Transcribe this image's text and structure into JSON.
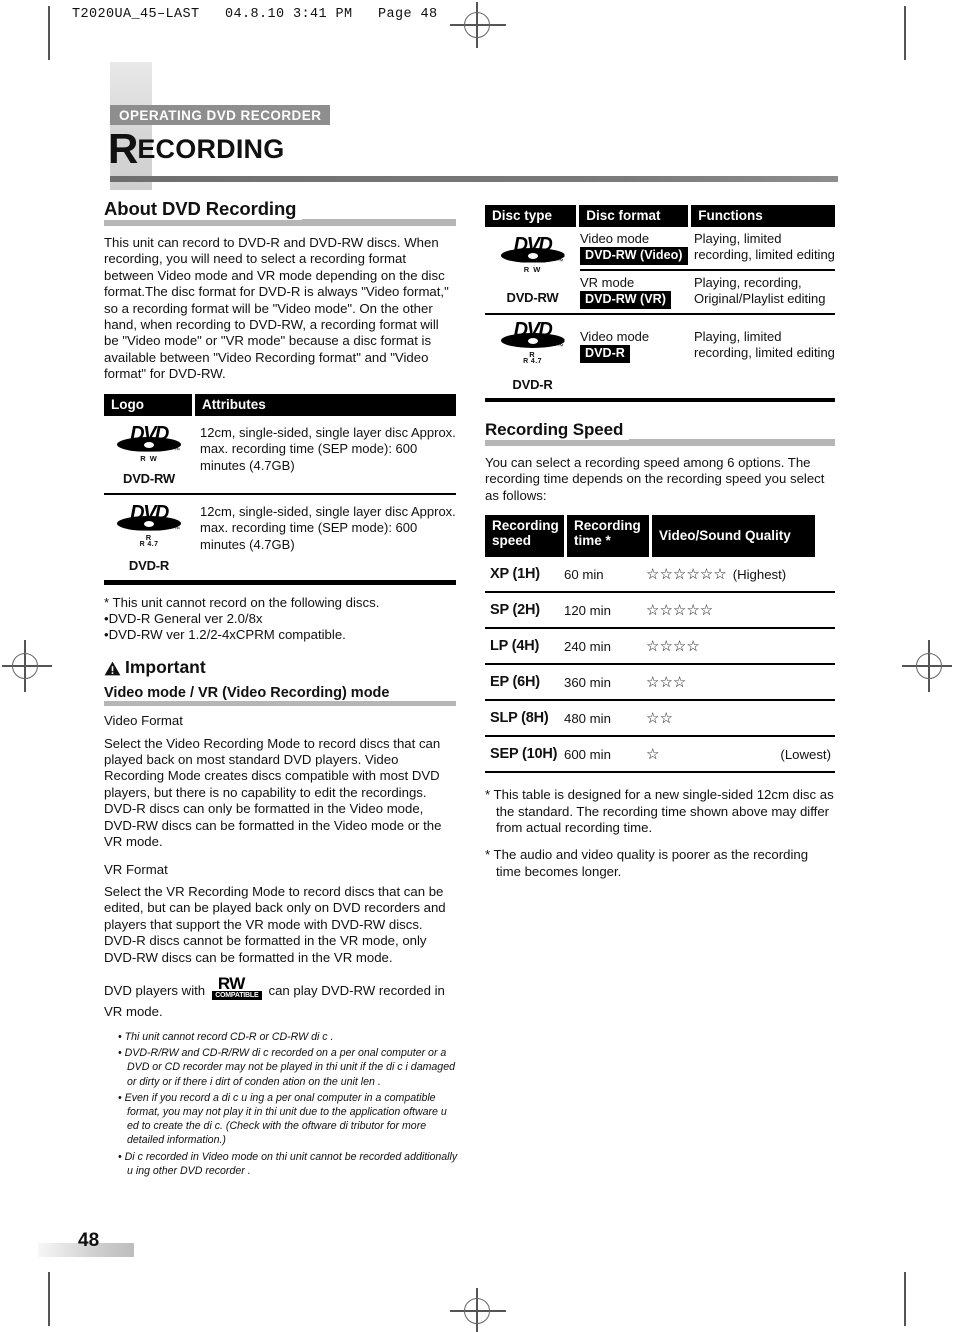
{
  "file_header": "T2020UA_45–LAST   04.8.10 3:41 PM   Page 48",
  "section_badge": "OPERATING DVD RECORDER",
  "chapter": {
    "dropcap": "R",
    "rest": "ECORDING"
  },
  "page_number": "48",
  "left": {
    "heading": "About DVD Recording",
    "intro": "This unit can record to DVD-R and DVD-RW discs. When recording, you will need to select a recording format between Video mode and VR mode depending on the disc format.The disc format for DVD-R is always \"Video format,\" so a recording format will be \"Video mode\". On the other hand, when recording to DVD-RW, a recording format will be \"Video mode\" or \"VR mode\" because a disc format is available between \"Video Recording format\" and \"Video format\" for DVD-RW.",
    "logo_table": {
      "headers": [
        "Logo",
        "Attributes"
      ],
      "rows": [
        {
          "logo": {
            "word": "DVD",
            "sub": "R W",
            "sub2": "",
            "caption": "DVD-RW"
          },
          "attributes": "12cm, single-sided, single layer disc Approx. max. recording time (SEP mode): 600 minutes (4.7GB)"
        },
        {
          "logo": {
            "word": "DVD",
            "sub": "R",
            "sub2": "R 4.7",
            "caption": "DVD-R"
          },
          "attributes": "12cm, single-sided, single layer disc Approx. max. recording time (SEP mode): 600 minutes (4.7GB)"
        }
      ]
    },
    "cannot_record_note": "* This unit cannot record on the following discs.",
    "cannot_record_items": [
      "•DVD-R General ver 2.0/8x",
      "•DVD-RW ver 1.2/2-4xCPRM compatible."
    ],
    "important_label": "Important",
    "important_subhead": "Video mode / VR (Video Recording) mode",
    "video_format_title": "Video Format",
    "video_format_body": "Select the Video Recording Mode to record discs that can played back on most standard DVD players. Video Recording Mode creates discs compatible with most DVD players, but there is no capability to edit the recordings. DVD-R discs can only be formatted in the Video mode, DVD-RW discs can be formatted in the Video mode or the VR mode.",
    "vr_format_title": "VR Format",
    "vr_format_body": "Select the VR Recording Mode to record discs that can be edited, but can be played back only on DVD recorders and players that support the VR mode with DVD-RW discs. DVD-R discs cannot be formatted in the VR mode, only DVD-RW discs can be formatted in the VR mode.",
    "rw_sentence_before": "DVD players with",
    "rw_logo": {
      "top": "RW",
      "bottom": "COMPATIBLE"
    },
    "rw_sentence_after": "can play DVD-RW recorded in VR mode.",
    "footnotes": [
      "• Thi  unit cannot record CD-R or CD-RW di c .",
      "• DVD-R/RW and CD-R/RW di c  recorded on a per onal computer or a DVD or CD recorder may not be played in thi  unit if the di c i  damaged or dirty or if there i  dirt of conden ation on the unit  len .",
      "• Even if you record a di c u ing a per onal computer in a compatible format, you may not play it in thi  unit due to the application  oftware u ed to create the di c. (Check with the  oftware di tributor for more detailed information.)",
      "• Di c  recorded in Video mode on thi  unit cannot be recorded additionally u ing other DVD recorder ."
    ]
  },
  "right": {
    "disc_table": {
      "headers": [
        "Disc type",
        "Disc format",
        "Functions"
      ],
      "groups": [
        {
          "logo": {
            "word": "DVD",
            "sub": "R W",
            "sub2": "",
            "caption": "DVD-RW"
          },
          "rows": [
            {
              "mode": "Video mode",
              "badge": "DVD-RW (Video)",
              "functions": "Playing, limited recording, limited editing"
            },
            {
              "mode": "VR mode",
              "badge": "DVD-RW (VR)",
              "functions": "Playing, recording, Original/Playlist editing"
            }
          ]
        },
        {
          "logo": {
            "word": "DVD",
            "sub": "R",
            "sub2": "R 4.7",
            "caption": "DVD-R"
          },
          "rows": [
            {
              "mode": "Video mode",
              "badge": "DVD-R",
              "functions": "Playing, limited recording, limited editing"
            }
          ]
        }
      ]
    },
    "speed_heading": "Recording Speed",
    "speed_intro": "You can select a recording speed among 6 options. The recording time depends on the recording speed you select as follows:",
    "speed_table": {
      "headers": [
        "Recording speed",
        "Recording time *",
        "Video/Sound Quality"
      ],
      "rows": [
        {
          "speed": "XP (1H)",
          "time": "60 min",
          "stars": 6,
          "note": "(Highest)",
          "note_right": false
        },
        {
          "speed": "SP (2H)",
          "time": "120 min",
          "stars": 5,
          "note": "",
          "note_right": false
        },
        {
          "speed": "LP (4H)",
          "time": "240 min",
          "stars": 4,
          "note": "",
          "note_right": false
        },
        {
          "speed": "EP (6H)",
          "time": "360 min",
          "stars": 3,
          "note": "",
          "note_right": false
        },
        {
          "speed": "SLP (8H)",
          "time": "480 min",
          "stars": 2,
          "note": "",
          "note_right": false
        },
        {
          "speed": "SEP (10H)",
          "time": "600 min",
          "stars": 1,
          "note": "(Lowest)",
          "note_right": true
        }
      ]
    },
    "table_notes": [
      "* This table is designed for a new single-sided 12cm disc as the standard. The recording time shown above may differ from actual recording time.",
      "* The audio and video quality is poorer as the recording time becomes longer."
    ]
  }
}
